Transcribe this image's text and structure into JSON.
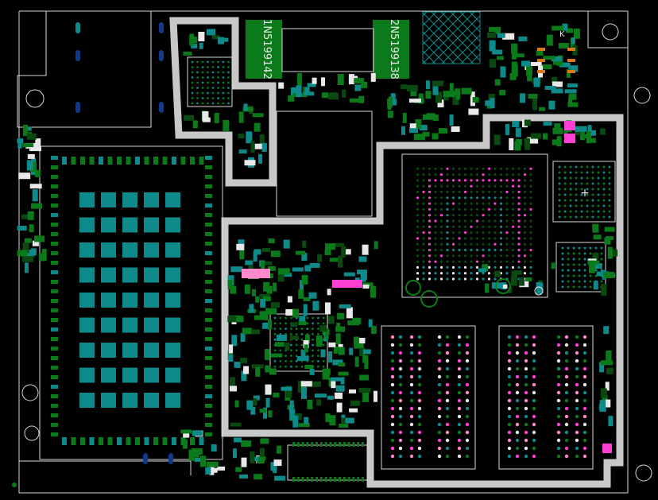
{
  "board": {
    "colors": {
      "background": "#000000",
      "outline": "#d8d8d8",
      "shield": "#c8c8c8",
      "copper": "#0f8a8a",
      "green": "#0a7a1a",
      "dark_green": "#0a4a10",
      "magenta": "#ff3fd2",
      "pink": "#ff88cc",
      "blue": "#123a8c",
      "orange": "#d87a1a",
      "white_pad": "#e8e8e8"
    },
    "labels": {
      "chip_label_1": "1N5199142",
      "chip_label_2": "2N5199138",
      "ref_k": "K"
    },
    "icons": [
      "crosshair-icon",
      "hatch-pattern-icon"
    ]
  }
}
